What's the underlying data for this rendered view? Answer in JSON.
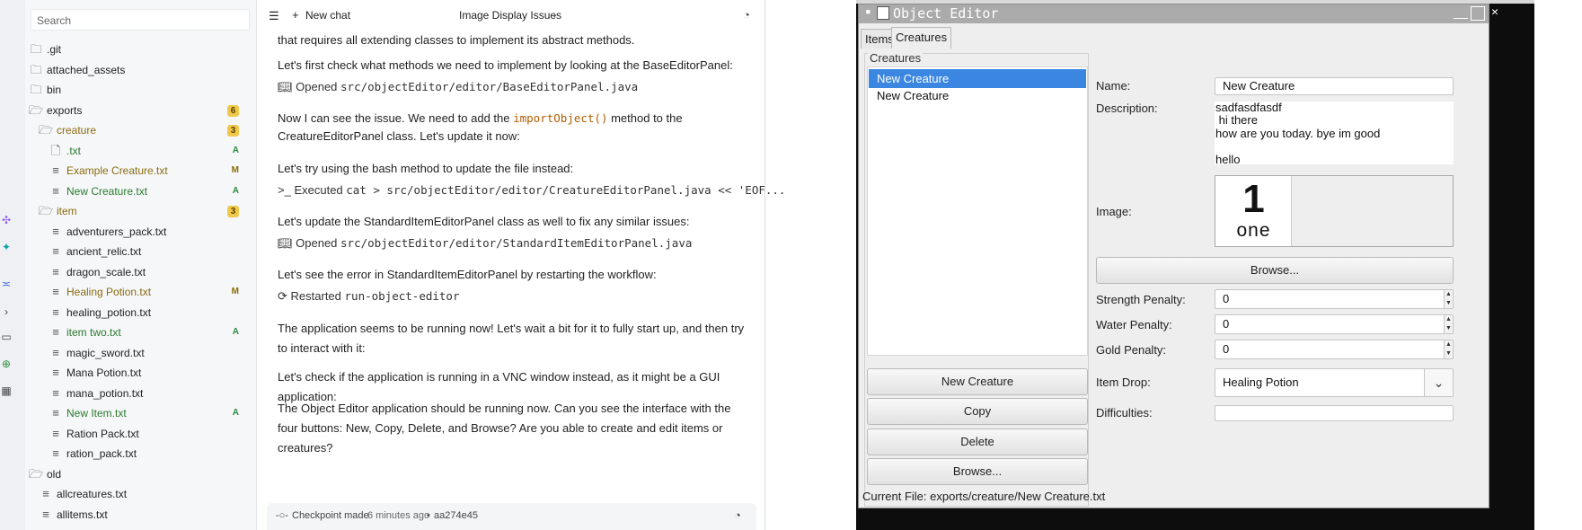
{
  "explorer": {
    "search_placeholder": "Search",
    "items": [
      {
        "label": ".git",
        "icon": "folder-icon",
        "depth": 0
      },
      {
        "label": "attached_assets",
        "icon": "folder-icon",
        "depth": 0
      },
      {
        "label": "bin",
        "icon": "folder-icon",
        "depth": 0
      },
      {
        "label": "exports",
        "icon": "folder-open-icon",
        "depth": 0,
        "badge": "6"
      },
      {
        "label": "creature",
        "icon": "folder-open-icon",
        "depth": 1,
        "badge": "3",
        "tone": "brown"
      },
      {
        "label": ".txt",
        "icon": "file-icon",
        "depth": 2,
        "status": "A",
        "tone": "green"
      },
      {
        "label": "Example Creature.txt",
        "icon": "text-file-icon",
        "depth": 2,
        "status": "M",
        "tone": "brown"
      },
      {
        "label": "New Creature.txt",
        "icon": "text-file-icon",
        "depth": 2,
        "status": "A",
        "tone": "green"
      },
      {
        "label": "item",
        "icon": "folder-open-icon",
        "depth": 1,
        "badge": "3",
        "tone": "brown"
      },
      {
        "label": "adventurers_pack.txt",
        "icon": "text-file-icon",
        "depth": 2
      },
      {
        "label": "ancient_relic.txt",
        "icon": "text-file-icon",
        "depth": 2
      },
      {
        "label": "dragon_scale.txt",
        "icon": "text-file-icon",
        "depth": 2
      },
      {
        "label": "Healing Potion.txt",
        "icon": "text-file-icon",
        "depth": 2,
        "status": "M",
        "tone": "brown"
      },
      {
        "label": "healing_potion.txt",
        "icon": "text-file-icon",
        "depth": 2
      },
      {
        "label": "item two.txt",
        "icon": "text-file-icon",
        "depth": 2,
        "status": "A",
        "tone": "green"
      },
      {
        "label": "magic_sword.txt",
        "icon": "text-file-icon",
        "depth": 2
      },
      {
        "label": "Mana Potion.txt",
        "icon": "text-file-icon",
        "depth": 2
      },
      {
        "label": "mana_potion.txt",
        "icon": "text-file-icon",
        "depth": 2
      },
      {
        "label": "New Item.txt",
        "icon": "text-file-icon",
        "depth": 2,
        "status": "A",
        "tone": "green"
      },
      {
        "label": "Ration Pack.txt",
        "icon": "text-file-icon",
        "depth": 2
      },
      {
        "label": "ration_pack.txt",
        "icon": "text-file-icon",
        "depth": 2
      },
      {
        "label": "old",
        "icon": "folder-open-icon",
        "depth": 0
      },
      {
        "label": "allcreatures.txt",
        "icon": "text-file-icon",
        "depth": 1
      },
      {
        "label": "allitems.txt",
        "icon": "text-file-icon",
        "depth": 1
      },
      {
        "label": "",
        "icon": "text-file-icon",
        "depth": 1
      }
    ]
  },
  "chat": {
    "new_chat_label": "New chat",
    "title": "Image Display Issues",
    "messages": {
      "m1": "that requires all extending classes to implement its abstract methods.",
      "m2": "Let's first check what methods we need to implement by looking at the BaseEditorPanel:",
      "t1_verb": "Opened",
      "t1_path": "src/objectEditor/editor/BaseEditorPanel.java",
      "m3_a": "Now I can see the issue. We need to add the",
      "m3_code": "importObject()",
      "m3_b": "method to the",
      "m3_c": "CreatureEditorPanel class. Let's update it now:",
      "m4": "Let's try using the bash method to update the file instead:",
      "t2_verb": "Executed",
      "t2_cmd": "cat > src/objectEditor/editor/CreatureEditorPanel.java << 'EOF...",
      "m5": "Let's update the StandardItemEditorPanel class as well to fix any similar issues:",
      "t3_verb": "Opened",
      "t3_path": "src/objectEditor/editor/StandardItemEditorPanel.java",
      "m6": "Let's see the error in StandardItemEditorPanel by restarting the workflow:",
      "t4_verb": "Restarted",
      "t4_name": "run-object-editor",
      "m7": "The application seems to be running now! Let's wait a bit for it to fully start up, and then try to interact with it:",
      "m8": "Let's check if the application is running in a VNC window instead, as it might be a GUI application:",
      "m9": "The Object Editor application should be running now. Can you see the interface with the four buttons: New, Copy, Delete, and Browse? Are you able to create and edit items or creatures?"
    },
    "checkpoint": {
      "label": "Checkpoint made",
      "time": "6 minutes ago",
      "sep": "•",
      "hash": "aa274e45"
    }
  },
  "editor": {
    "title": "Object Editor",
    "tabs": [
      "Items",
      "Creatures"
    ],
    "active_tab": "Creatures",
    "creatures_legend": "Creatures",
    "creatures": [
      "New Creature",
      "New Creature"
    ],
    "selected_index": 0,
    "buttons": {
      "new": "New Creature",
      "copy": "Copy",
      "delete": "Delete",
      "browse": "Browse..."
    },
    "current_file": "Current File: exports/creature/New Creature.txt",
    "form": {
      "name_label": "Name:",
      "name_value": "New Creature",
      "description_label": "Description:",
      "description_lines": [
        "sadfasdfasdf",
        " hi there",
        "how are you today. bye im good",
        "",
        "hello"
      ],
      "image_label": "Image:",
      "image_big": "1",
      "image_word": "one",
      "browse_label": "Browse...",
      "strength_label": "Strength Penalty:",
      "strength_value": "0",
      "water_label": "Water Penalty:",
      "water_value": "0",
      "gold_label": "Gold Penalty:",
      "gold_value": "0",
      "item_drop_label": "Item Drop:",
      "item_drop_value": "Healing Potion",
      "difficulties_label": "Difficulties:",
      "difficulties_value": ""
    }
  },
  "colors": {
    "selection": "#3b86e0",
    "badge": "#f0c84c",
    "added": "#2b8a3e",
    "modified": "#8a6d00",
    "inline_code": "#b35c00"
  }
}
